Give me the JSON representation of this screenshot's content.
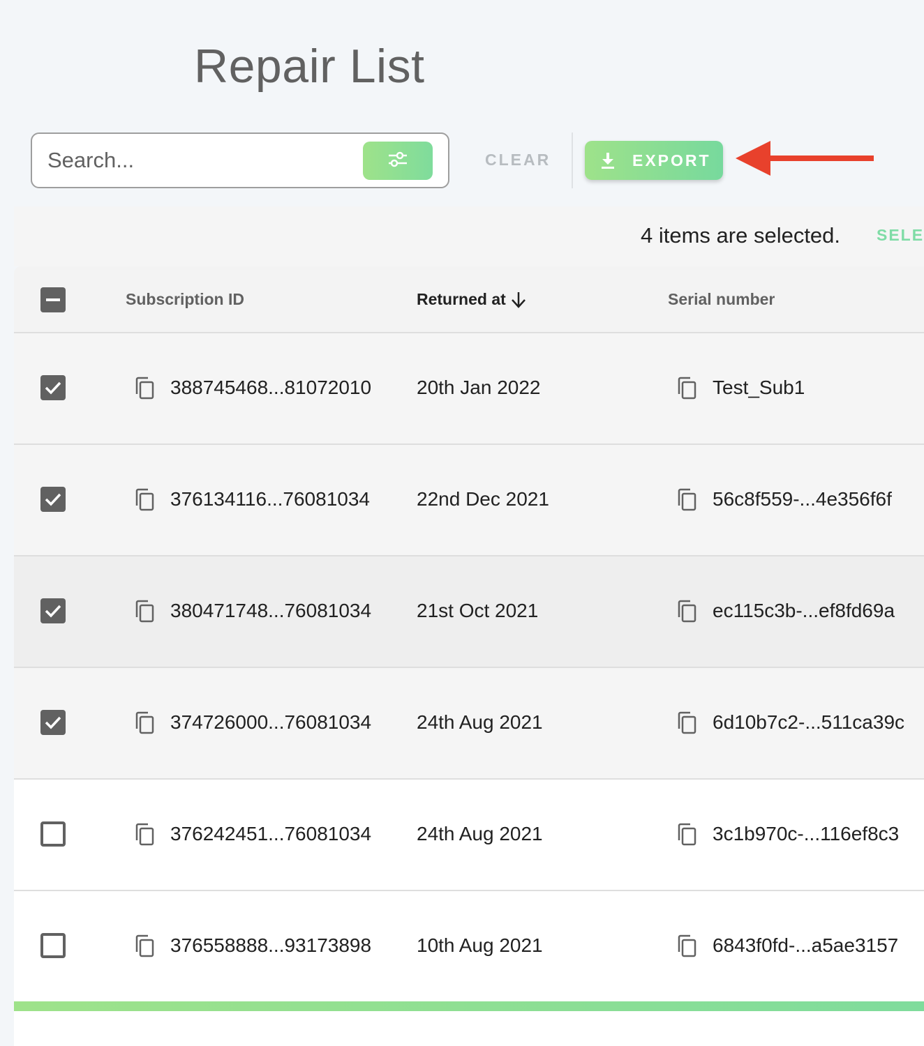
{
  "page": {
    "title": "Repair List"
  },
  "toolbar": {
    "search_placeholder": "Search...",
    "clear_label": "CLEAR",
    "export_label": "EXPORT"
  },
  "selection": {
    "text": "4 items are selected.",
    "select_all_label": "SELEC"
  },
  "table": {
    "headers": {
      "subscription_id": "Subscription ID",
      "returned_at": "Returned at",
      "serial_number": "Serial number"
    },
    "sort": {
      "column": "returned_at",
      "direction": "descending"
    },
    "rows": [
      {
        "checked": true,
        "subscription_id": "388745468...81072010",
        "returned_at": "20th Jan 2022",
        "serial_number": "Test_Sub1"
      },
      {
        "checked": true,
        "subscription_id": "376134116...76081034",
        "returned_at": "22nd Dec 2021",
        "serial_number": "56c8f559-...4e356f6f"
      },
      {
        "checked": true,
        "subscription_id": "380471748...76081034",
        "returned_at": "21st Oct 2021",
        "serial_number": "ec115c3b-...ef8fd69a"
      },
      {
        "checked": true,
        "subscription_id": "374726000...76081034",
        "returned_at": "24th Aug 2021",
        "serial_number": "6d10b7c2-...511ca39c"
      },
      {
        "checked": false,
        "subscription_id": "376242451...76081034",
        "returned_at": "24th Aug 2021",
        "serial_number": "3c1b970c-...116ef8c3"
      },
      {
        "checked": false,
        "subscription_id": "376558888...93173898",
        "returned_at": "10th Aug 2021",
        "serial_number": "6843f0fd-...a5ae3157"
      }
    ]
  },
  "colors": {
    "accent_green": "#86de94",
    "annotation_arrow": "#e8412c",
    "checkbox": "#616161"
  },
  "icons": {
    "filter": "sliders-icon",
    "export": "download-icon",
    "copy": "copy-icon",
    "sort": "arrow-down-icon"
  }
}
